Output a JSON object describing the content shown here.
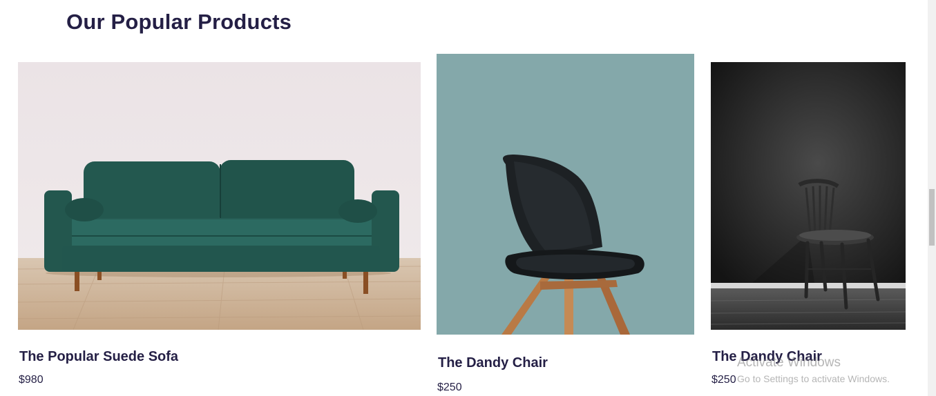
{
  "section": {
    "title": "Our Popular Products"
  },
  "products": [
    {
      "name": "The Popular Suede Sofa",
      "price": "$980",
      "image_icon": "green-sofa-image"
    },
    {
      "name": "The Dandy Chair",
      "price": "$250",
      "image_icon": "black-chair-image"
    },
    {
      "name": "The Dandy Chair",
      "price": "$250",
      "image_icon": "wooden-chair-image"
    }
  ],
  "watermark": {
    "title": "Activate Windows",
    "subtitle": "Go to Settings to activate Windows."
  },
  "colors": {
    "heading": "#241f45",
    "chair_background": "#84a8aa",
    "sofa_green": "#265c54"
  }
}
